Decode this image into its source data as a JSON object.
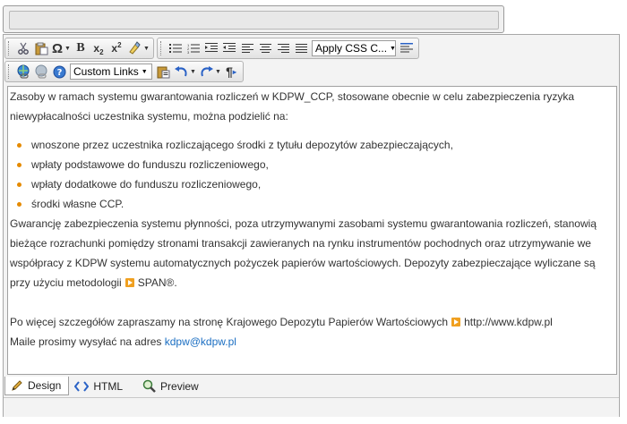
{
  "toolbar": {
    "icons_row1_group1": [
      "cut-icon",
      "paste-icon",
      "special-chars-icon",
      "bold-icon",
      "subscript-icon",
      "superscript-icon",
      "format-clear-icon"
    ],
    "special_chars_glyph": "Ω",
    "bold_glyph": "B",
    "subscript_glyph": "x",
    "superscript_glyph": "x",
    "css_select_label": "Apply CSS C...",
    "links_select_label": "Custom Links",
    "paragraph_glyph": "¶"
  },
  "content": {
    "intro": "Zasoby w ramach systemu gwarantowania rozliczeń w KDPW_CCP, stosowane obecnie w celu zabezpieczenia ryzyka niewypłacalności uczestnika systemu, można podzielić na:",
    "bullets": [
      "wnoszone przez uczestnika rozliczającego środki z tytułu depozytów zabezpieczających,",
      "wpłaty podstawowe do funduszu rozliczeniowego,",
      "wpłaty dodatkowe do funduszu rozliczeniowego,",
      "środki własne CCP."
    ],
    "para2": " Gwarancję zabezpieczenia systemu płynności, poza utrzymywanymi zasobami systemu gwarantowania rozliczeń, stanowią bieżące rozrachunki pomiędzy stronami transakcji zawieranych na rynku instrumentów pochodnych oraz utrzymywanie we współpracy z KDPW systemu automatycznych pożyczek papierów wartościowych. Depozyty zabezpieczające wyliczane są przy użyciu metodologii",
    "span_link": "SPAN®.",
    "more_info": "Po więcej szczegółów zapraszamy na stronę Krajowego Depozytu Papierów Wartościowych",
    "site_link": "http://www.kdpw.pl",
    "mail_text": "Maile prosimy wysyłać na adres",
    "mail_link": "kdpw@kdpw.pl"
  },
  "modes": {
    "design": "Design",
    "html": "HTML",
    "preview": "Preview"
  },
  "colors": {
    "bullet": "#e58a00",
    "link": "#1a6ec2",
    "accent_icon": "#2a62c6"
  }
}
